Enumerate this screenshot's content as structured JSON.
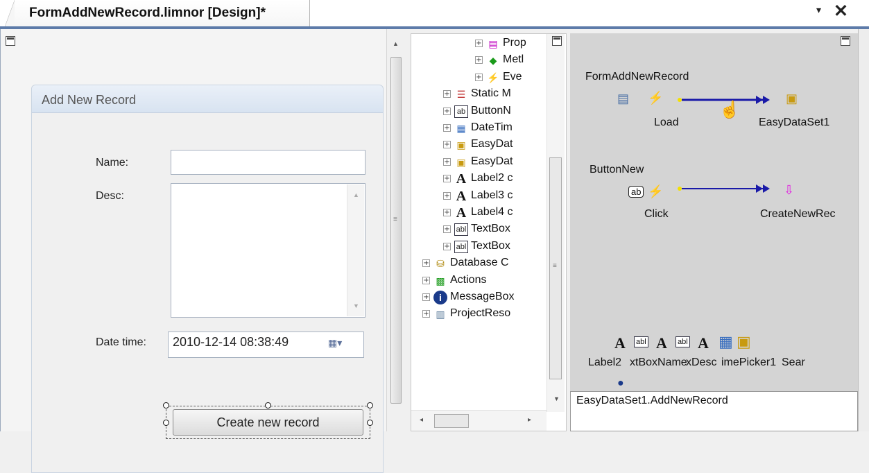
{
  "tab": {
    "title": "FormAddNewRecord.limnor [Design]*",
    "dropdown_glyph": "▾",
    "close_glyph": "✕"
  },
  "form": {
    "title": "Add New Record",
    "name_label": "Name:",
    "name_value": "",
    "desc_label": "Desc:",
    "desc_value": "",
    "datetime_label": "Date time:",
    "datetime_value": "2010-12-14 08:38:49",
    "create_button_label": "Create new record"
  },
  "tree": {
    "items": [
      {
        "label": "Prop",
        "icon": "properties-icon",
        "glyph": "▤",
        "color": "#c000c0"
      },
      {
        "label": "Metl",
        "icon": "methods-icon",
        "glyph": "◆",
        "color": "#1a9a1a"
      },
      {
        "label": "Eve",
        "icon": "events-icon",
        "glyph": "⚡",
        "color": "#8a2be2"
      },
      {
        "label": "Static M",
        "icon": "static-members-icon",
        "glyph": "☰",
        "color": "#c03030"
      },
      {
        "label": "ButtonN",
        "icon": "button-icon",
        "glyph": "ab",
        "color": "#222222"
      },
      {
        "label": "DateTim",
        "icon": "datetime-picker-icon",
        "glyph": "▦",
        "color": "#3a6fbf"
      },
      {
        "label": "EasyDat",
        "icon": "dataset-icon",
        "glyph": "▣",
        "color": "#c89a10"
      },
      {
        "label": "EasyDat",
        "icon": "dataset-icon",
        "glyph": "▣",
        "color": "#c89a10"
      },
      {
        "label": "Label2 c",
        "icon": "label-icon",
        "glyph": "A",
        "color": "#111111"
      },
      {
        "label": "Label3 c",
        "icon": "label-icon",
        "glyph": "A",
        "color": "#111111"
      },
      {
        "label": "Label4 c",
        "icon": "label-icon",
        "glyph": "A",
        "color": "#111111"
      },
      {
        "label": "TextBox",
        "icon": "textbox-icon",
        "glyph": "abl",
        "color": "#222222"
      },
      {
        "label": "TextBox",
        "icon": "textbox-icon",
        "glyph": "abl",
        "color": "#222222"
      },
      {
        "label": "Database C",
        "icon": "database-icon",
        "glyph": "⛁",
        "color": "#b08a10"
      },
      {
        "label": "Actions",
        "icon": "actions-icon",
        "glyph": "▩",
        "color": "#1a9a1a"
      },
      {
        "label": "MessageBox",
        "icon": "info-icon",
        "glyph": "i",
        "color": "#1a3a8a"
      },
      {
        "label": "ProjectReso",
        "icon": "resources-icon",
        "glyph": "▥",
        "color": "#5a7a9a"
      }
    ]
  },
  "map": {
    "form_node": "FormAddNewRecord",
    "load_label": "Load",
    "dataset_label": "EasyDataSet1",
    "button_node": "ButtonNew",
    "click_label": "Click",
    "method_label": "CreateNewRec",
    "bottom_labels": [
      "Label2",
      "xtBoxName",
      "xDesc",
      "imePicker1",
      "Sear"
    ]
  },
  "action_text": "EasyDataSet1.AddNewRecord",
  "colors": {
    "accent": "#5d7ba9",
    "link": "#1a1aa8"
  }
}
